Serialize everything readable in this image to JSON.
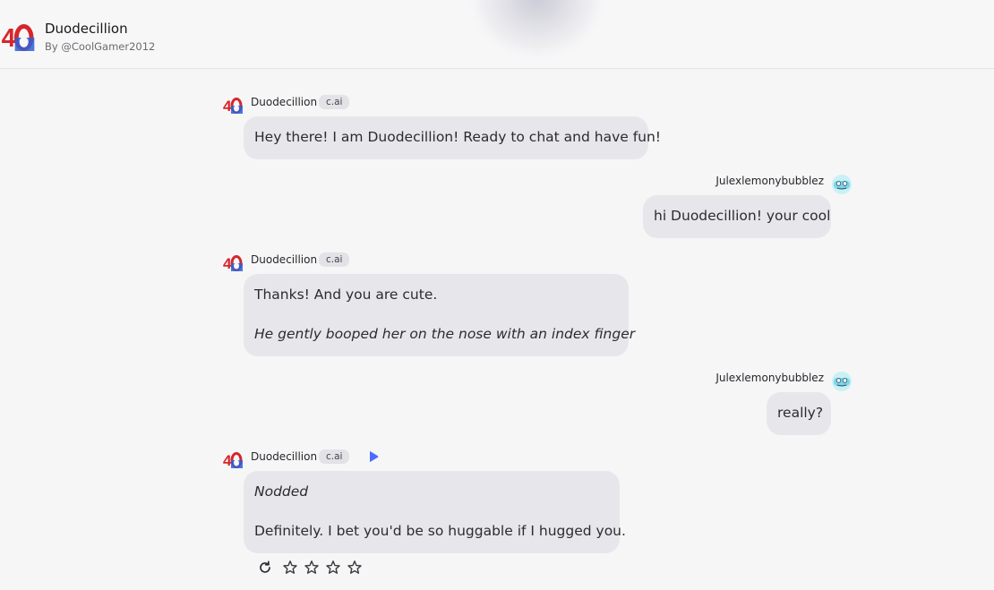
{
  "header": {
    "title": "Duodecillion",
    "byline": "By @CoolGamer2012"
  },
  "messages": [
    {
      "sender": "Duodecillion",
      "tag": "c.ai",
      "lines": [
        "Hey there! I am Duodecillion! Ready to chat and have fun!"
      ]
    },
    {
      "sender": "Julexlemonybubblez",
      "lines": [
        "hi Duodecillion! your cool"
      ]
    },
    {
      "sender": "Duodecillion",
      "tag": "c.ai",
      "lines": [
        "Thanks! And you are cute.",
        "He gently booped her on the nose with an index finger"
      ]
    },
    {
      "sender": "Julexlemonybubblez",
      "lines": [
        "really?"
      ]
    },
    {
      "sender": "Duodecillion",
      "tag": "c.ai",
      "lines": [
        "Nodded",
        "Definitely. I bet you'd be so huggable if I hugged you."
      ]
    }
  ],
  "icons": {
    "bot_avatar": "duodecillion-avatar",
    "user_avatar": "blue-face-avatar",
    "play": "play-icon",
    "regenerate": "refresh-icon",
    "rating": "star-icon"
  },
  "colors": {
    "background": "#f6f6f7",
    "bubble": "#e7e7eb",
    "accent": "#4d6bff"
  }
}
